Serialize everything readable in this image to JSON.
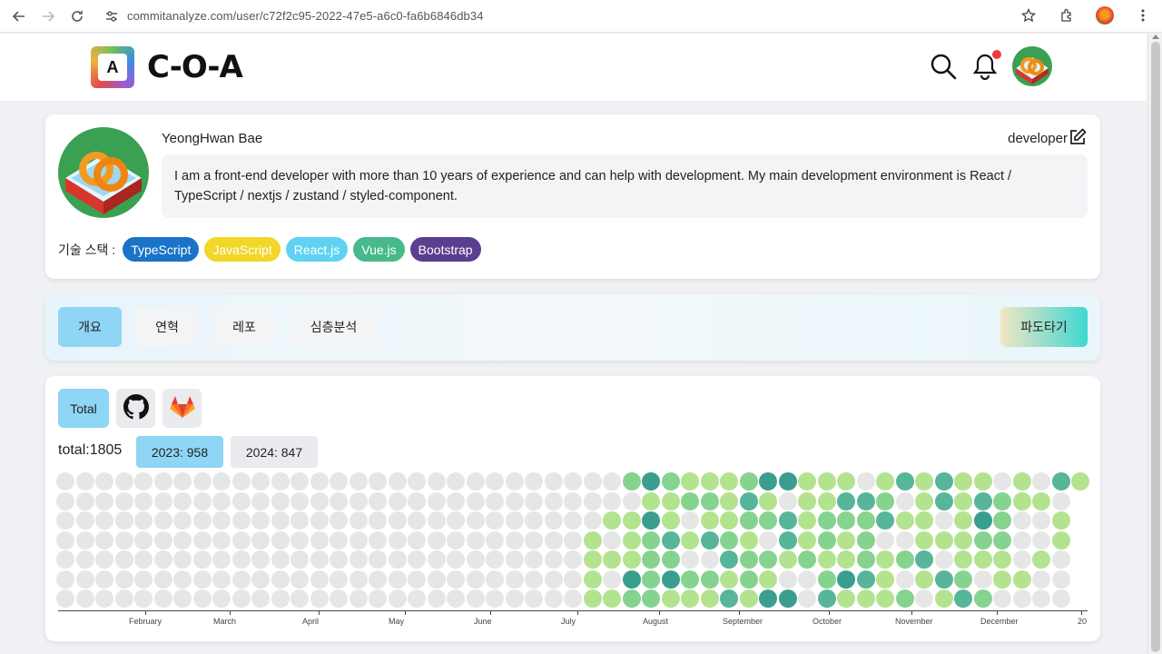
{
  "browser": {
    "url": "commitanalyze.com/user/c72f2c95-2022-47e5-a6c0-fa6b6846db34"
  },
  "header": {
    "logo_mark_text": "A",
    "logo_text": "C-O-A"
  },
  "profile": {
    "name": "YeongHwan Bae",
    "role": "developer",
    "bio": "I am a front-end developer with more than 10 years of experience and can help with development. My main development environment is React / TypeScript / nextjs / zustand / styled-component.",
    "stack_label": "기술 스택 :",
    "stack": [
      {
        "label": "TypeScript",
        "color": "#1a73c8",
        "text": "#ffffff"
      },
      {
        "label": "JavaScript",
        "color": "#f2d628",
        "text": "#ffffff"
      },
      {
        "label": "React.js",
        "color": "#5fd2f2",
        "text": "#ffffff"
      },
      {
        "label": "Vue.js",
        "color": "#48b98a",
        "text": "#ffffff"
      },
      {
        "label": "Bootstrap",
        "color": "#5a3f8f",
        "text": "#ffffff"
      }
    ]
  },
  "tabs": {
    "items": [
      "개요",
      "연혁",
      "레포",
      "심층분석"
    ],
    "active": 0,
    "wave_label": "파도타기"
  },
  "graph": {
    "sources": {
      "total_label": "Total",
      "github": "github-icon",
      "gitlab": "gitlab-icon"
    },
    "total_text": "total:1805",
    "years": [
      "2023: 958",
      "2024: 847"
    ],
    "active_year": 0,
    "months": [
      "February",
      "March",
      "April",
      "May",
      "June",
      "July",
      "August",
      "September",
      "October",
      "November",
      "December",
      "20"
    ],
    "levels_colors": [
      "#e6e6e6",
      "#b3e38f",
      "#86d38f",
      "#57b59a",
      "#3a9e8e"
    ]
  }
}
